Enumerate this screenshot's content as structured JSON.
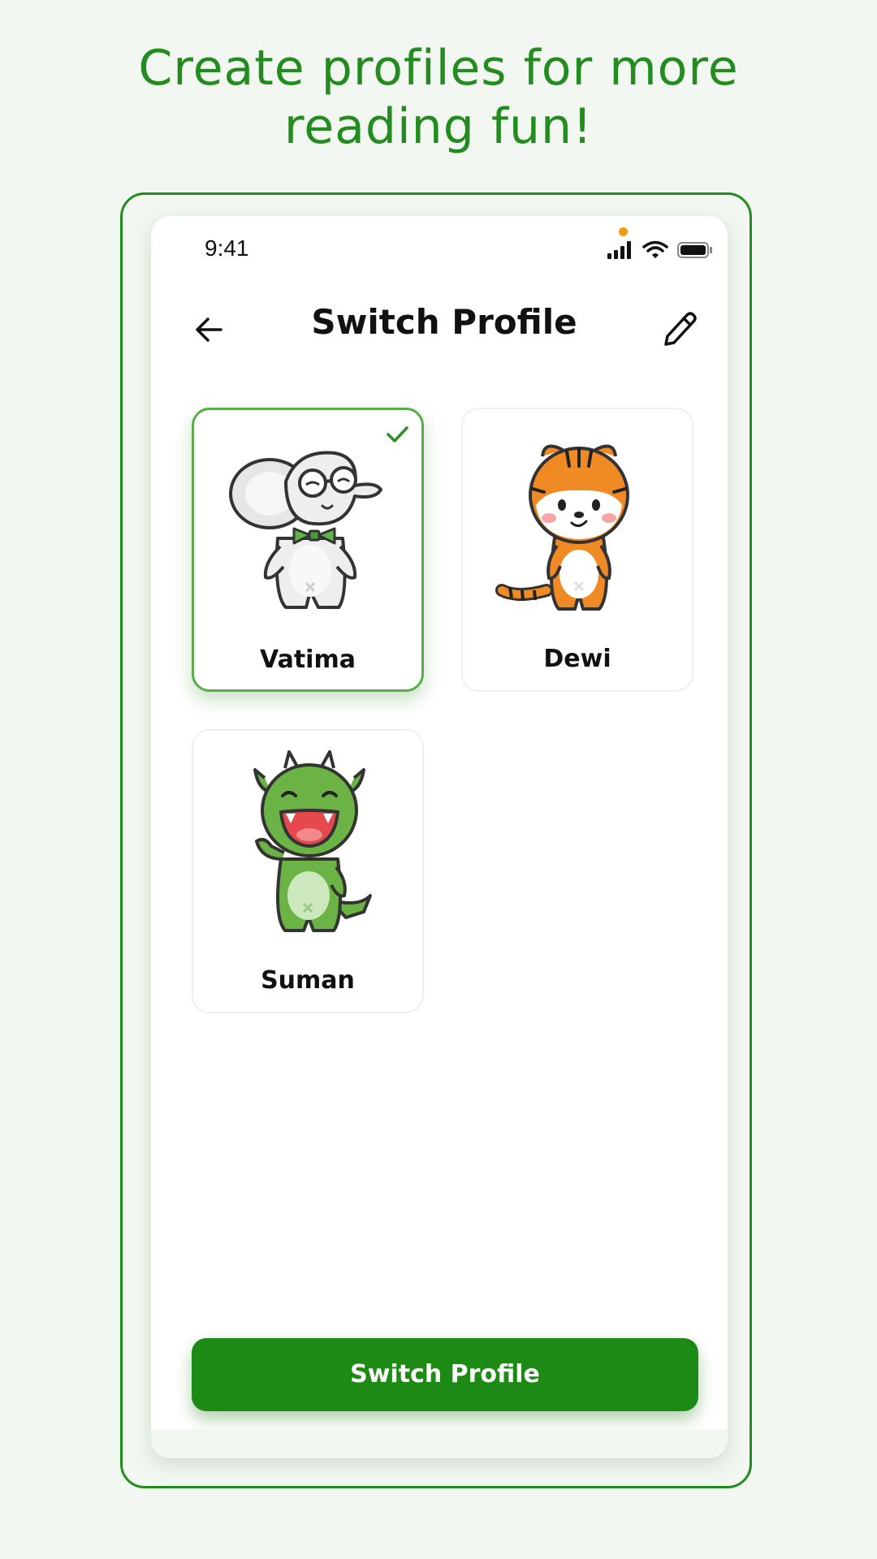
{
  "headline": {
    "line1": "Create profiles for more",
    "line2": "reading fun!"
  },
  "status_bar": {
    "time": "9:41",
    "icons": [
      "signal-icon",
      "wifi-icon",
      "battery-icon"
    ]
  },
  "nav": {
    "title": "Switch Profile",
    "back_icon": "arrow-left-icon",
    "edit_icon": "pencil-icon"
  },
  "profiles": [
    {
      "name": "Vatima",
      "avatar": "elephant-avatar",
      "selected": true
    },
    {
      "name": "Dewi",
      "avatar": "tiger-avatar",
      "selected": false
    },
    {
      "name": "Suman",
      "avatar": "dragon-avatar",
      "selected": false
    }
  ],
  "cta": {
    "label": "Switch Profile"
  },
  "colors": {
    "brand_green": "#238c1e",
    "button_green": "#1e8a16",
    "selected_border": "#58ad4a",
    "background": "#f2f7f1"
  }
}
